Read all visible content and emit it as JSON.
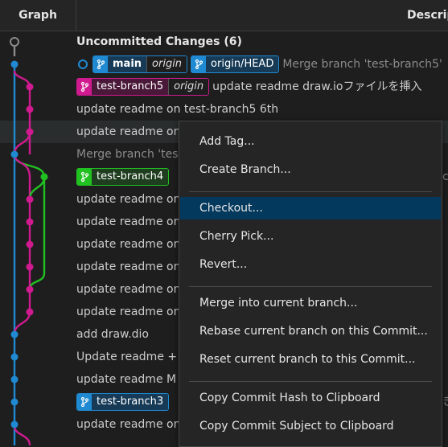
{
  "header": {
    "graph": "Graph",
    "description": "Descrip"
  },
  "rows": [
    {
      "type": "uncommitted",
      "text": "Uncommitted Changes (6)"
    },
    {
      "type": "refs",
      "head": true,
      "refs": [
        {
          "name": "main",
          "origin": "origin",
          "color": "blue",
          "bold": true
        },
        {
          "name": "origin/HEAD",
          "color": "blue"
        }
      ],
      "text": "Merge branch 'test-branch5'"
    },
    {
      "type": "refs",
      "refs": [
        {
          "name": "test-branch5",
          "origin": "origin",
          "color": "pink"
        }
      ],
      "text": "update readme draw.ioファイルを挿入"
    },
    {
      "type": "plain",
      "text": "update readme on test-branch5 6th"
    },
    {
      "type": "plain",
      "text": "update readme on"
    },
    {
      "type": "merge",
      "text": "Merge branch 'tes"
    },
    {
      "type": "refs",
      "refs": [
        {
          "name": "test-branch4",
          "color": "green"
        }
      ],
      "text": "",
      "trail": "c"
    },
    {
      "type": "plain",
      "text": "update readme on"
    },
    {
      "type": "plain",
      "text": "update readme on"
    },
    {
      "type": "plain",
      "text": "update readme on"
    },
    {
      "type": "plain",
      "text": "update readme on"
    },
    {
      "type": "plain",
      "text": "update readme on"
    },
    {
      "type": "plain",
      "text": "update readme on"
    },
    {
      "type": "plain",
      "text": "add draw.dio"
    },
    {
      "type": "plain",
      "text": "Update readme +"
    },
    {
      "type": "plain",
      "text": "update readme M"
    },
    {
      "type": "refs",
      "refs": [
        {
          "name": "test-branch3",
          "color": "blue"
        }
      ],
      "text": "",
      "trail": "き"
    },
    {
      "type": "plain",
      "text": "update readme on"
    }
  ],
  "context_menu": {
    "items": [
      {
        "label": "Add Tag..."
      },
      {
        "label": "Create Branch..."
      },
      {
        "separator": true
      },
      {
        "label": "Checkout...",
        "selected": true
      },
      {
        "label": "Cherry Pick..."
      },
      {
        "label": "Revert..."
      },
      {
        "separator": true
      },
      {
        "label": "Merge into current branch..."
      },
      {
        "label": "Rebase current branch on this Commit..."
      },
      {
        "label": "Reset current branch to this Commit..."
      },
      {
        "separator": true
      },
      {
        "label": "Copy Commit Hash to Clipboard"
      },
      {
        "label": "Copy Commit Subject to Clipboard"
      }
    ]
  },
  "colors": {
    "blue": "#1f8ad2",
    "pink": "#d01a8f",
    "green": "#22c122",
    "uncommitted": "#8b8b8b"
  }
}
